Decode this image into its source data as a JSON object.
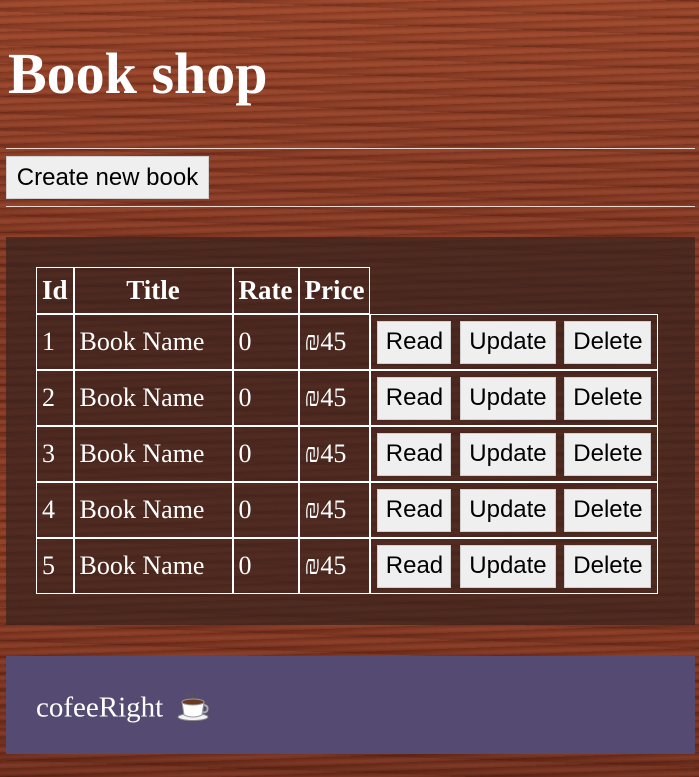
{
  "header": {
    "title": "Book shop"
  },
  "toolbar": {
    "create_label": "Create new book"
  },
  "table": {
    "columns": [
      "Id",
      "Title",
      "Rate",
      "Price"
    ],
    "rows": [
      {
        "id": "1",
        "title": "Book Name",
        "rate": "0",
        "price": "₪45"
      },
      {
        "id": "2",
        "title": "Book Name",
        "rate": "0",
        "price": "₪45"
      },
      {
        "id": "3",
        "title": "Book Name",
        "rate": "0",
        "price": "₪45"
      },
      {
        "id": "4",
        "title": "Book Name",
        "rate": "0",
        "price": "₪45"
      },
      {
        "id": "5",
        "title": "Book Name",
        "rate": "0",
        "price": "₪45"
      }
    ],
    "actions": {
      "read": "Read",
      "update": "Update",
      "delete": "Delete"
    }
  },
  "footer": {
    "text": "cofeeRight",
    "icon": "coffee-cup-icon"
  },
  "colors": {
    "footer_bg": "#554a72",
    "panel_bg": "#37231e",
    "page_bg": "#8a3a22"
  }
}
